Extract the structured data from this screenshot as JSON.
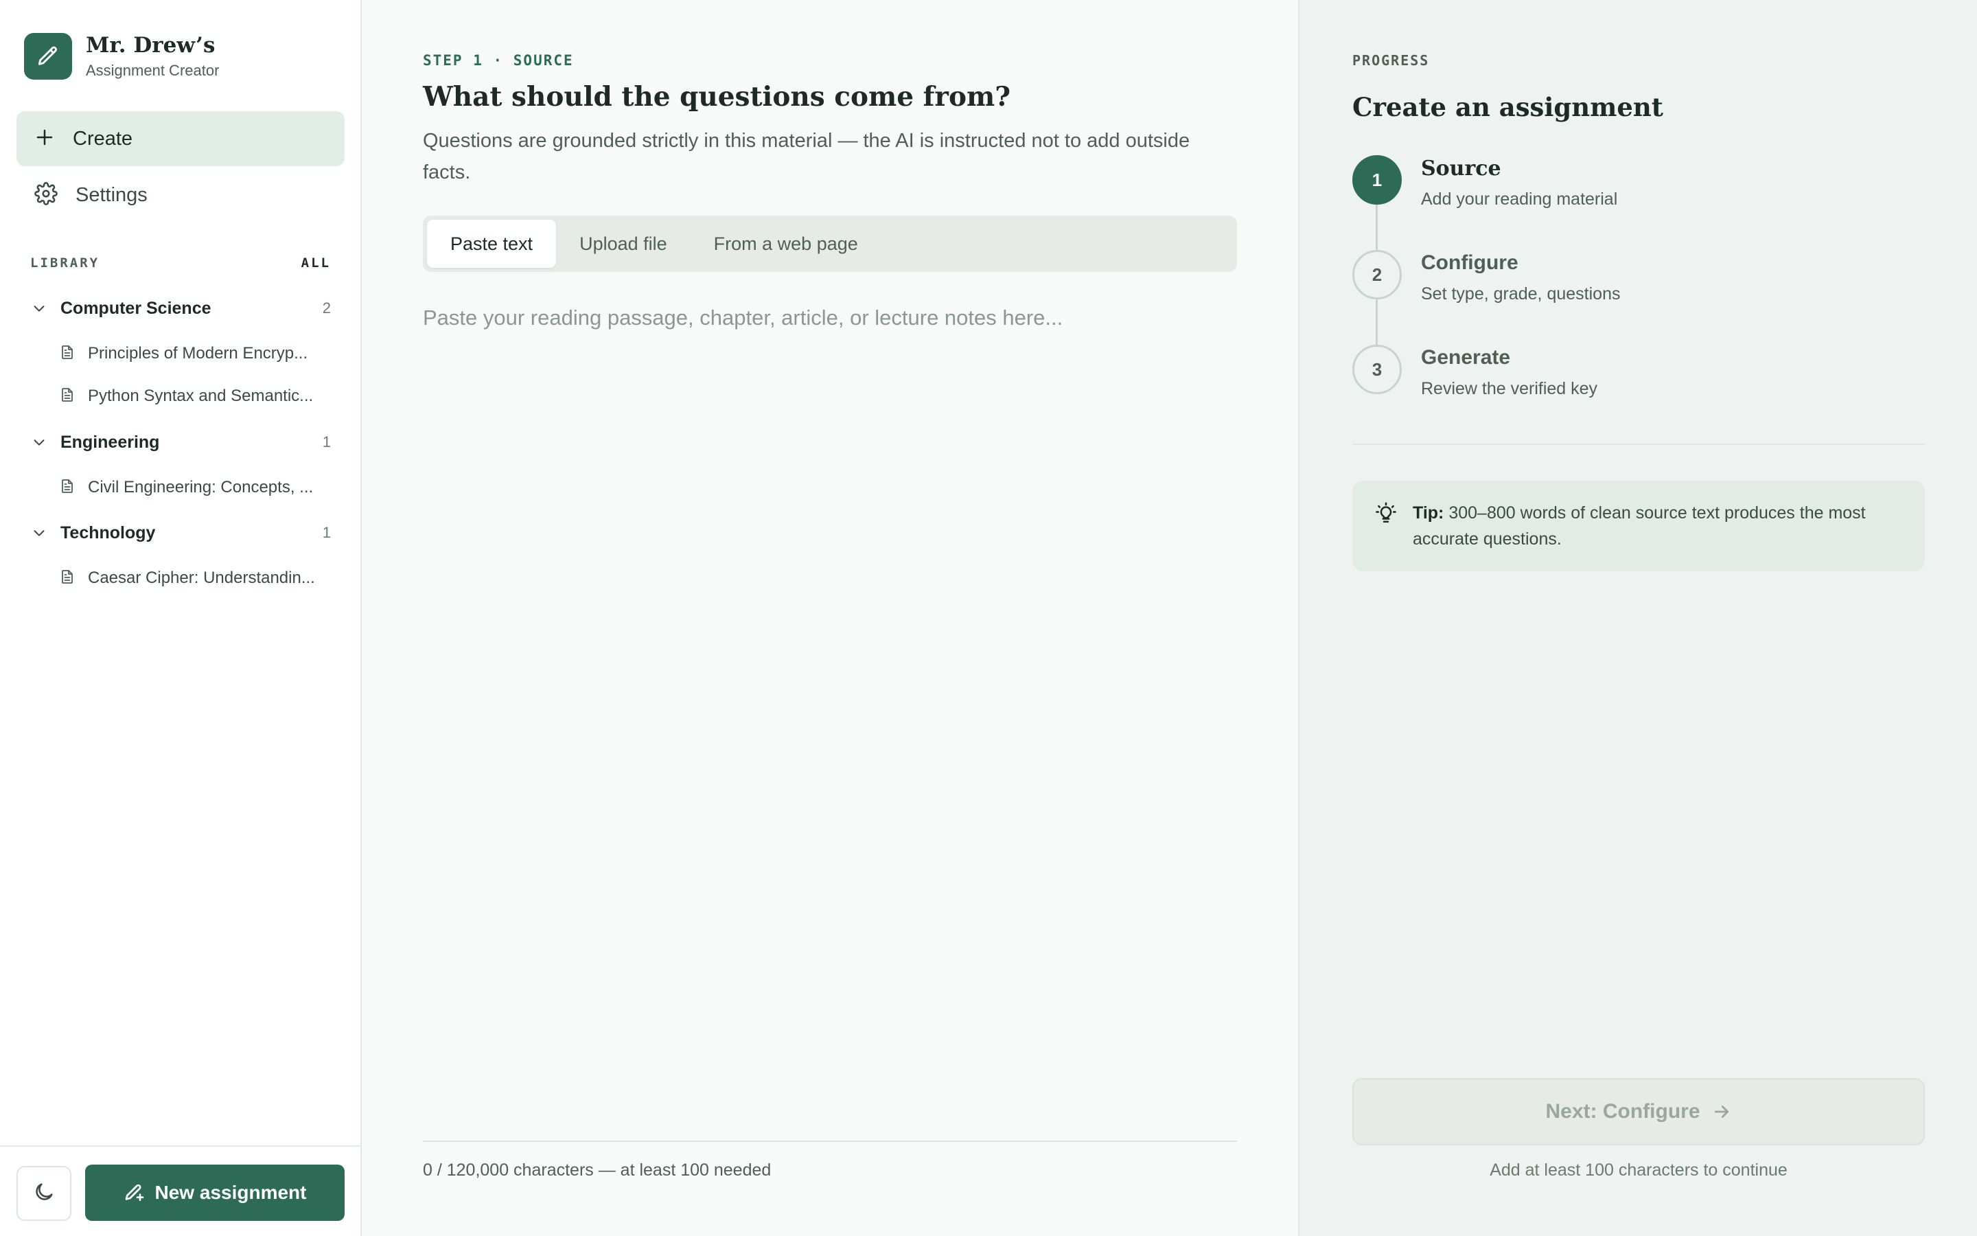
{
  "brand": {
    "title": "Mr. Drew’s",
    "subtitle": "Assignment Creator",
    "icon": "pencil-icon"
  },
  "nav": {
    "create_label": "Create",
    "settings_label": "Settings"
  },
  "library": {
    "heading": "LIBRARY",
    "all_label": "ALL",
    "categories": [
      {
        "name": "Computer Science",
        "count": "2",
        "docs": [
          "Principles of Modern Encryp...",
          "Python Syntax and Semantic..."
        ]
      },
      {
        "name": "Engineering",
        "count": "1",
        "docs": [
          "Civil Engineering: Concepts, ..."
        ]
      },
      {
        "name": "Technology",
        "count": "1",
        "docs": [
          "Caesar Cipher: Understandin..."
        ]
      }
    ]
  },
  "sidebar_footer": {
    "new_assignment_label": "New assignment",
    "theme_icon": "moon-icon"
  },
  "main": {
    "step_label": "STEP 1 · SOURCE",
    "title": "What should the questions come from?",
    "description": "Questions are grounded strictly in this material — the AI is instructed not to add outside facts.",
    "tabs": [
      {
        "label": "Paste text",
        "active": true
      },
      {
        "label": "Upload file",
        "active": false
      },
      {
        "label": "From a web page",
        "active": false
      }
    ],
    "input_value": "",
    "input_placeholder": "Paste your reading passage, chapter, article, or lecture notes here...",
    "char_count": "0 / 120,000 characters — at least 100 needed"
  },
  "progress": {
    "label": "PROGRESS",
    "title": "Create an assignment",
    "steps": [
      {
        "number": "1",
        "name": "Source",
        "sub": "Add your reading material",
        "active": true
      },
      {
        "number": "2",
        "name": "Configure",
        "sub": "Set type, grade, questions",
        "active": false
      },
      {
        "number": "3",
        "name": "Generate",
        "sub": "Review the verified key",
        "active": false
      }
    ],
    "tip_label": "Tip:",
    "tip_text": "300–800 words of clean source text produces the most accurate questions.",
    "next_label": "Next: Configure",
    "next_hint": "Add at least 100 characters to continue"
  },
  "colors": {
    "accent": "#2e6b56",
    "accent_soft": "#e3ede8",
    "panel": "#eef2f0"
  }
}
